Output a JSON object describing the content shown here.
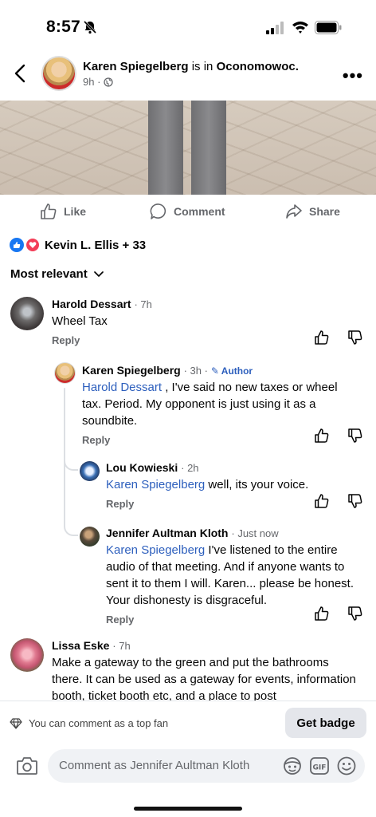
{
  "status": {
    "time": "8:57"
  },
  "header": {
    "author": "Karen Spiegelberg",
    "is_in": " is in ",
    "place": "Oconomowoc.",
    "meta": "9h ·"
  },
  "actions": {
    "like": "Like",
    "comment": "Comment",
    "share": "Share"
  },
  "reactions": {
    "summary": "Kevin L. Ellis + 33"
  },
  "sort": {
    "label": "Most relevant"
  },
  "comments": [
    {
      "name": "Harold Dessart",
      "time": "· 7h",
      "text": "Wheel Tax",
      "reply": "Reply"
    },
    {
      "name": "Karen Spiegelberg",
      "time": "· 3h ·",
      "author": "Author",
      "mention": "Harold Dessart",
      "text": " , I've said no new taxes or wheel tax. Period. My opponent is just using it as a soundbite.",
      "reply": "Reply"
    },
    {
      "name": "Lou Kowieski",
      "time": "· 2h",
      "mention": "Karen Spiegelberg",
      "text": " well, its your voice.",
      "reply": "Reply"
    },
    {
      "name": "Jennifer Aultman Kloth",
      "time": "· Just now",
      "mention": "Karen Spiegelberg",
      "text": " I've listened to the entire audio of that meeting. And if anyone wants to sent it to them I will. Karen... please be honest. Your dishonesty is disgraceful.",
      "reply": "Reply"
    },
    {
      "name": "Lissa Eske",
      "time": "· 7h",
      "text": "Make a gateway to the green and put the bathrooms there. It can be used as a gateway for events, information booth, ticket booth etc, and a place to post"
    }
  ],
  "bottom": {
    "topfan": "You can comment as a top fan",
    "get_badge": "Get badge",
    "placeholder": "Comment as Jennifer Aultman Kloth"
  },
  "colors": {
    "accent": "#1877f2",
    "mention": "#2d5fbd",
    "love": "#f33e58"
  }
}
